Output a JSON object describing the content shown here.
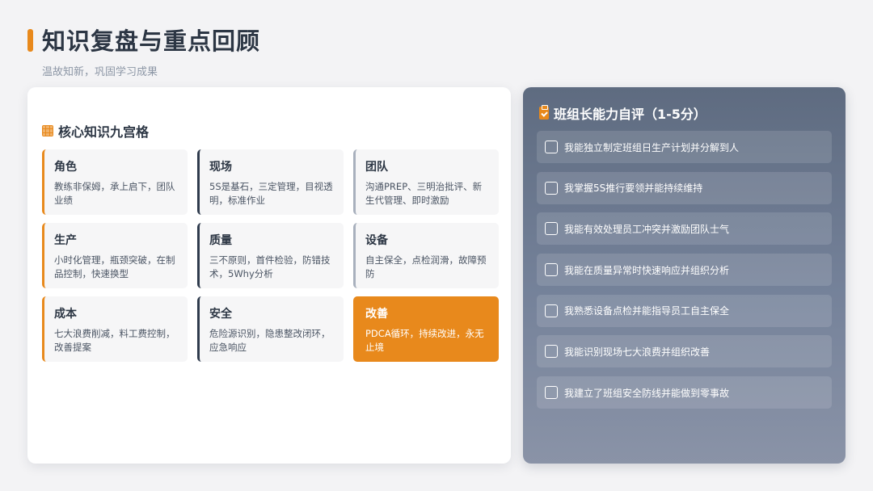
{
  "header": {
    "title": "知识复盘与重点回顾",
    "subtitle": "温故知新，巩固学习成果"
  },
  "colors": {
    "accent": "#e8891c",
    "navy": "#2f3b4d",
    "gray": "#a8b0bd"
  },
  "knowledge_grid": {
    "icon": "grid-icon",
    "title": "核心知识九宫格",
    "cards": [
      {
        "title": "角色",
        "desc": "教练非保姆，承上启下，团队业绩"
      },
      {
        "title": "现场",
        "desc": "5S是基石，三定管理，目视透明，标准作业"
      },
      {
        "title": "团队",
        "desc": "沟通PREP、三明治批评、新生代管理、即时激励"
      },
      {
        "title": "生产",
        "desc": "小时化管理，瓶颈突破，在制品控制，快速换型"
      },
      {
        "title": "质量",
        "desc": "三不原则，首件检验，防错技术，5Why分析"
      },
      {
        "title": "设备",
        "desc": "自主保全，点检润滑，故障预防"
      },
      {
        "title": "成本",
        "desc": "七大浪费削减，料工费控制，改善提案"
      },
      {
        "title": "安全",
        "desc": "危险源识别，隐患整改闭环，应急响应"
      },
      {
        "title": "改善",
        "desc": "PDCA循环，持续改进，永无止境"
      }
    ]
  },
  "self_assessment": {
    "icon": "clipboard-check-icon",
    "title": "班组长能力自评（1-5分）",
    "items": [
      "我能独立制定班组日生产计划并分解到人",
      "我掌握5S推行要领并能持续维持",
      "我能有效处理员工冲突并激励团队士气",
      "我能在质量异常时快速响应并组织分析",
      "我熟悉设备点检并能指导员工自主保全",
      "我能识别现场七大浪费并组织改善",
      "我建立了班组安全防线并能做到零事故"
    ]
  }
}
